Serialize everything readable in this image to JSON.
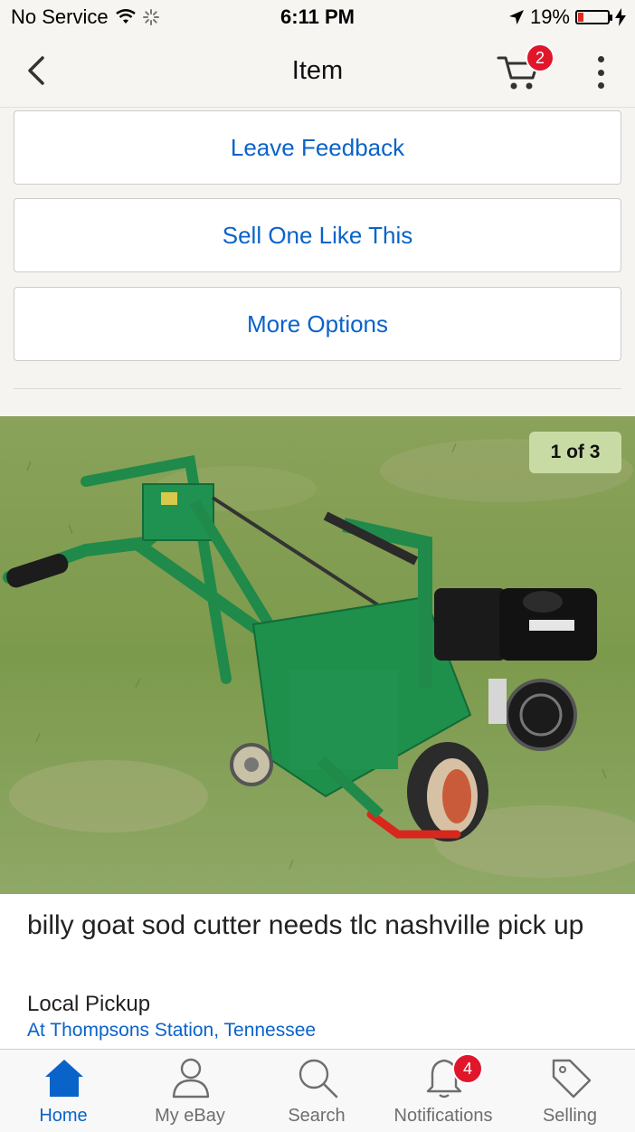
{
  "status_bar": {
    "carrier": "No Service",
    "time": "6:11 PM",
    "battery": "19%",
    "battery_level": 0.19
  },
  "nav": {
    "title": "Item",
    "cart_count": "2"
  },
  "actions": {
    "leave_feedback": "Leave Feedback",
    "sell_one": "Sell One Like This",
    "more_options": "More Options"
  },
  "photo": {
    "counter": "1 of 3"
  },
  "item": {
    "title": "billy goat sod cutter needs tlc nashville pick up",
    "pickup_label": "Local Pickup",
    "pickup_location": "At Thompsons Station, Tennessee"
  },
  "tabs": [
    {
      "label": "Home",
      "icon": "home-icon",
      "active": true
    },
    {
      "label": "My eBay",
      "icon": "person-icon"
    },
    {
      "label": "Search",
      "icon": "search-icon"
    },
    {
      "label": "Notifications",
      "icon": "bell-icon",
      "badge": "4"
    },
    {
      "label": "Selling",
      "icon": "tag-icon"
    }
  ],
  "colors": {
    "link_blue": "#0a63c9",
    "badge_red": "#e0162b",
    "background": "#f5f4f1"
  }
}
